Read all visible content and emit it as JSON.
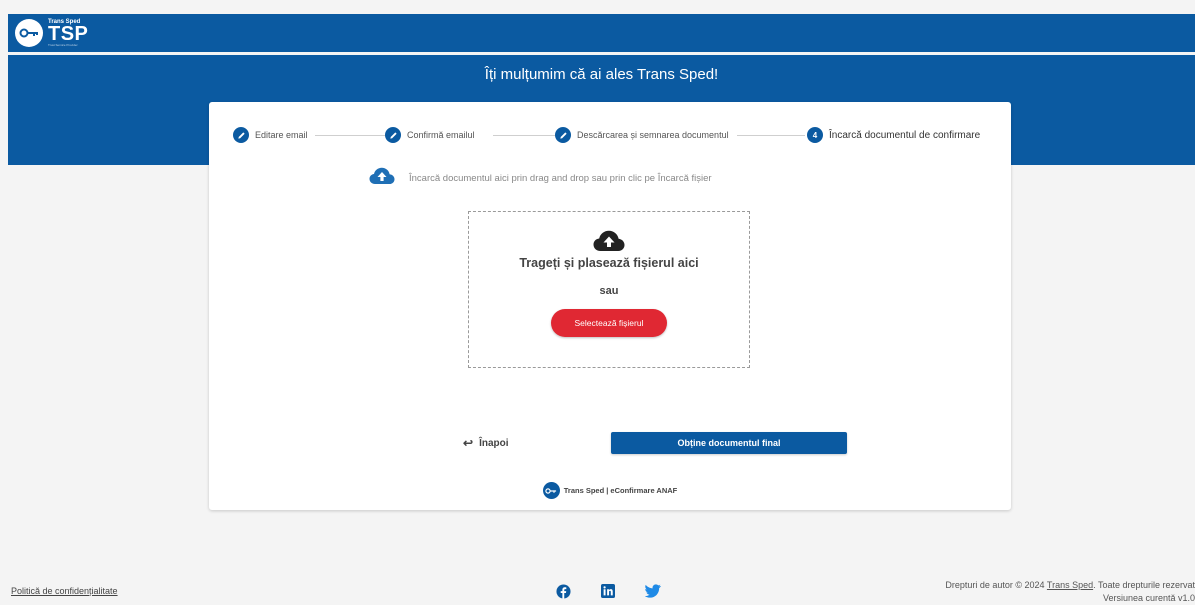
{
  "header": {
    "logo_brand": "Trans Sped",
    "logo_text": "TSP",
    "logo_tagline": "Trust Service Provider",
    "welcome": "Îți mulțumim că ai ales Trans Sped!"
  },
  "stepper": {
    "steps": [
      {
        "label": "Editare email",
        "icon": "pencil-icon"
      },
      {
        "label": "Confirmă emailul",
        "icon": "pencil-icon"
      },
      {
        "label": "Descărcarea și semnarea documentul",
        "icon": "pencil-icon"
      },
      {
        "number": "4",
        "label": "Încarcă documentul de confirmare"
      }
    ]
  },
  "upload": {
    "hint": "Încarcă documentul aici prin drag and drop sau prin clic pe Încarcă fișier",
    "title": "Trageți și plasează fișierul aici",
    "or": "sau",
    "select_button": "Selectează fișierul"
  },
  "actions": {
    "back": "Înapoi",
    "final": "Obține documentul final"
  },
  "card_footer": {
    "text": "Trans Sped | eConfirmare ANAF"
  },
  "footer": {
    "privacy": "Politică de confidențialitate",
    "copyright_prefix": "Drepturi de autor © 2024",
    "copyright_link": "Trans Sped",
    "copyright_suffix": ". Toate drepturile rezervat",
    "version": "Versiunea curentă v1.0"
  },
  "colors": {
    "primary": "#0b5aa1",
    "accent_red": "#e02833",
    "background": "#f4f4f4"
  }
}
